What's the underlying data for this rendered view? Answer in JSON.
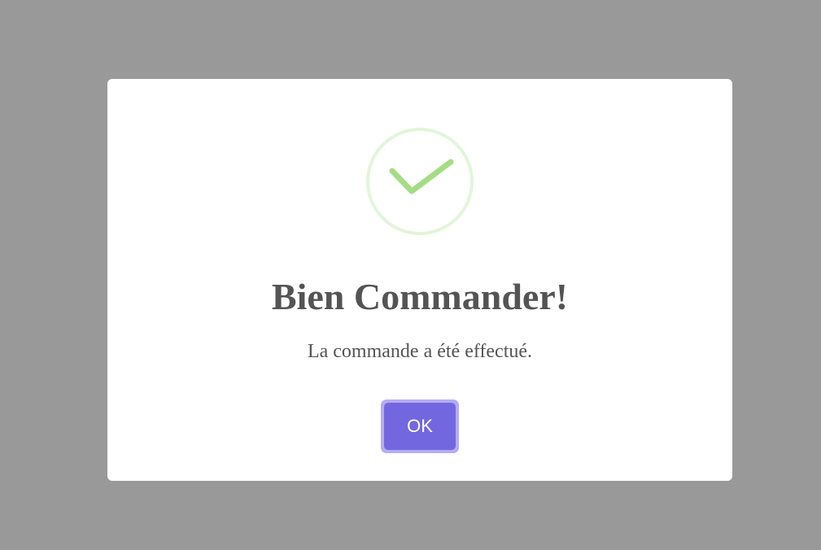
{
  "dialog": {
    "icon": "success-check-icon",
    "title": "Bien Commander!",
    "message": "La commande a été effectué.",
    "confirm_label": "OK"
  },
  "colors": {
    "backdrop": "#999999",
    "dialog_background": "#ffffff",
    "text": "#545454",
    "success_ring": "#e2f5d9",
    "success_check": "#a5dc86",
    "button": "#7367e0",
    "button_focus_ring": "#b4acf2"
  }
}
